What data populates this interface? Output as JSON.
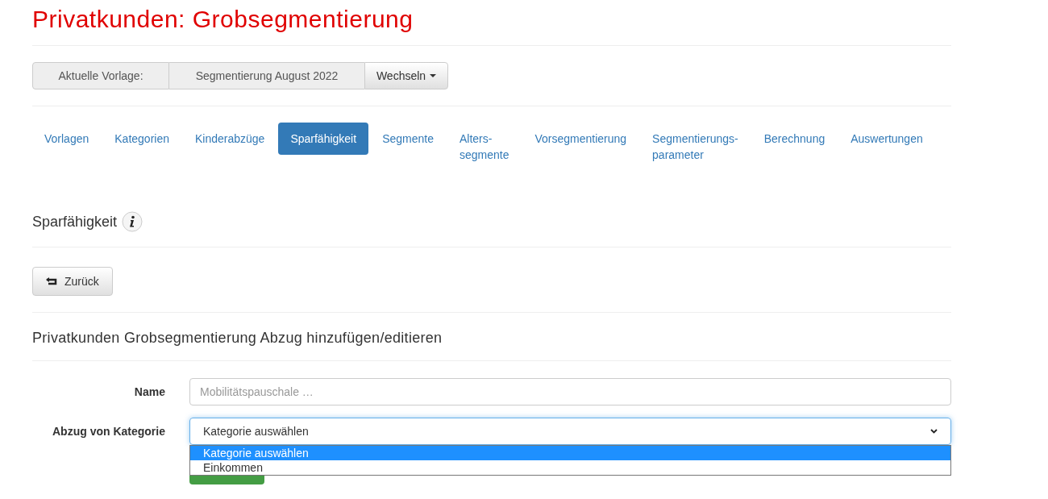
{
  "title": "Privatkunden: Grobsegmentierung",
  "template": {
    "label": "Aktuelle Vorlage:",
    "value": "Segmentierung August 2022",
    "button": "Wechseln"
  },
  "tabs": [
    {
      "label": "Vorlagen",
      "selected": false
    },
    {
      "label": "Kategorien",
      "selected": false
    },
    {
      "label": "Kinderabzüge",
      "selected": false
    },
    {
      "label": "Sparfähigkeit",
      "selected": true
    },
    {
      "label": "Segmente",
      "selected": false
    },
    {
      "label": "Alters-\nsegmente",
      "selected": false
    },
    {
      "label": "Vorsegmentierung",
      "selected": false
    },
    {
      "label": "Segmentierungs-\nparameter",
      "selected": false
    },
    {
      "label": "Berechnung",
      "selected": false
    },
    {
      "label": "Auswertungen",
      "selected": false
    }
  ],
  "section_title": "Sparfähigkeit",
  "back_button": "Zurück",
  "form_title": "Privatkunden Grobsegmentierung Abzug hinzufügen/editieren",
  "fields": [
    {
      "label": "Name",
      "placeholder": "Mobilitätspauschale …"
    },
    {
      "label": "Abzug von Kategorie",
      "value": "Kategorie auswählen",
      "options": [
        {
          "label": "Kategorie auswählen",
          "selected": true
        },
        {
          "label": "Einkommen",
          "selected": false
        }
      ]
    }
  ]
}
